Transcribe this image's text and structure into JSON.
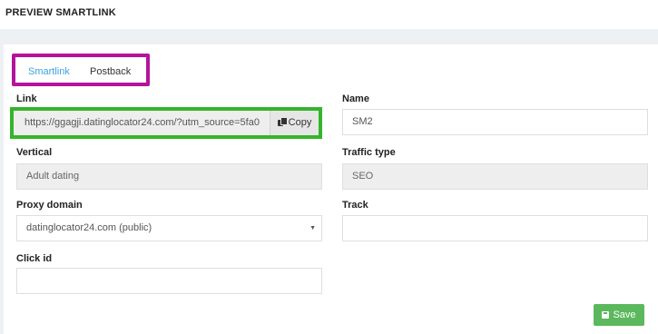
{
  "page": {
    "title": "PREVIEW SMARTLINK"
  },
  "tabs": [
    {
      "label": "Smartlink",
      "active": true
    },
    {
      "label": "Postback",
      "active": false
    }
  ],
  "form": {
    "link": {
      "label": "Link",
      "value": "https://ggagji.datinglocator24.com/?utm_source=5fa0",
      "copy_label": "Copy",
      "copy_icon": "copy-icon"
    },
    "name": {
      "label": "Name",
      "value": "SM2"
    },
    "vertical": {
      "label": "Vertical",
      "value": "Adult dating"
    },
    "traffic_type": {
      "label": "Traffic type",
      "value": "SEO"
    },
    "proxy_domain": {
      "label": "Proxy domain",
      "value": "datinglocator24.com (public)"
    },
    "track": {
      "label": "Track",
      "value": ""
    },
    "click_id": {
      "label": "Click id",
      "value": ""
    }
  },
  "actions": {
    "save_label": "Save",
    "save_icon": "floppy-disk-icon"
  },
  "colors": {
    "tab_highlight": "#b5139a",
    "link_highlight": "#35b52a",
    "active_tab": "#3aa3e3",
    "save_button": "#5cb85c"
  }
}
